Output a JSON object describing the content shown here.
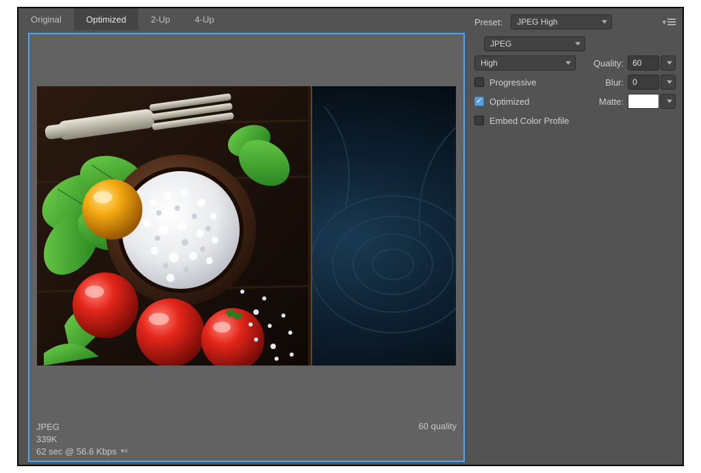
{
  "tabs": {
    "original": "Original",
    "optimized": "Optimized",
    "twoup": "2-Up",
    "fourup": "4-Up"
  },
  "status": {
    "format": "JPEG",
    "size": "339K",
    "transfer": "62 sec @ 56.6 Kbps",
    "quality": "60 quality"
  },
  "settings": {
    "preset_label": "Preset:",
    "preset_value": "JPEG High",
    "format_value": "JPEG",
    "quality_preset_value": "High",
    "quality_label": "Quality:",
    "quality_value": "60",
    "progressive_label": "Progressive",
    "blur_label": "Blur:",
    "blur_value": "0",
    "optimized_label": "Optimized",
    "matte_label": "Matte:",
    "embed_label": "Embed Color Profile"
  },
  "colors": {
    "matte_swatch": "#ffffff"
  }
}
